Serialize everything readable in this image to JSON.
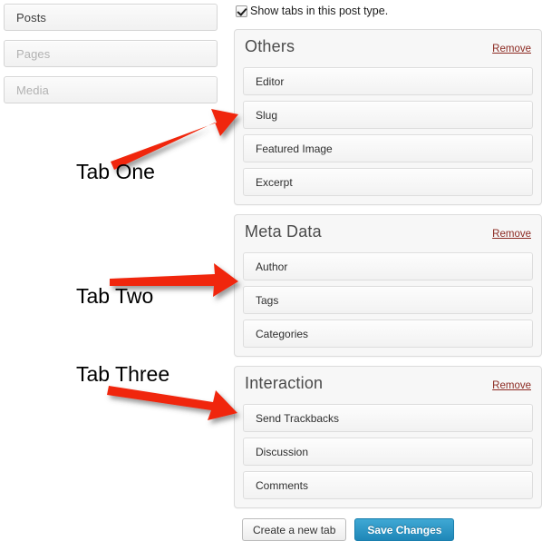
{
  "post_types": {
    "items": [
      {
        "label": "Posts",
        "active": true
      },
      {
        "label": "Pages",
        "active": false
      },
      {
        "label": "Media",
        "active": false
      }
    ]
  },
  "show_tabs": {
    "label": "Show tabs in this post type.",
    "checked": true
  },
  "panels": [
    {
      "title": "Others",
      "remove_label": "Remove",
      "fields": [
        "Editor",
        "Slug",
        "Featured Image",
        "Excerpt"
      ]
    },
    {
      "title": "Meta Data",
      "remove_label": "Remove",
      "fields": [
        "Author",
        "Tags",
        "Categories"
      ]
    },
    {
      "title": "Interaction",
      "remove_label": "Remove",
      "fields": [
        "Send Trackbacks",
        "Discussion",
        "Comments"
      ]
    }
  ],
  "footer": {
    "create_tab_label": "Create a new tab",
    "save_changes_label": "Save Changes"
  },
  "annotations": {
    "arrow_color": "#f02808",
    "items": [
      {
        "label": "Tab One"
      },
      {
        "label": "Tab Two"
      },
      {
        "label": "Tab Three"
      }
    ]
  },
  "colors": {
    "accent_blue": "#2189b9",
    "remove_red": "#8c2a22",
    "annotation_red": "#f02808",
    "panel_bg": "#f7f7f7"
  }
}
